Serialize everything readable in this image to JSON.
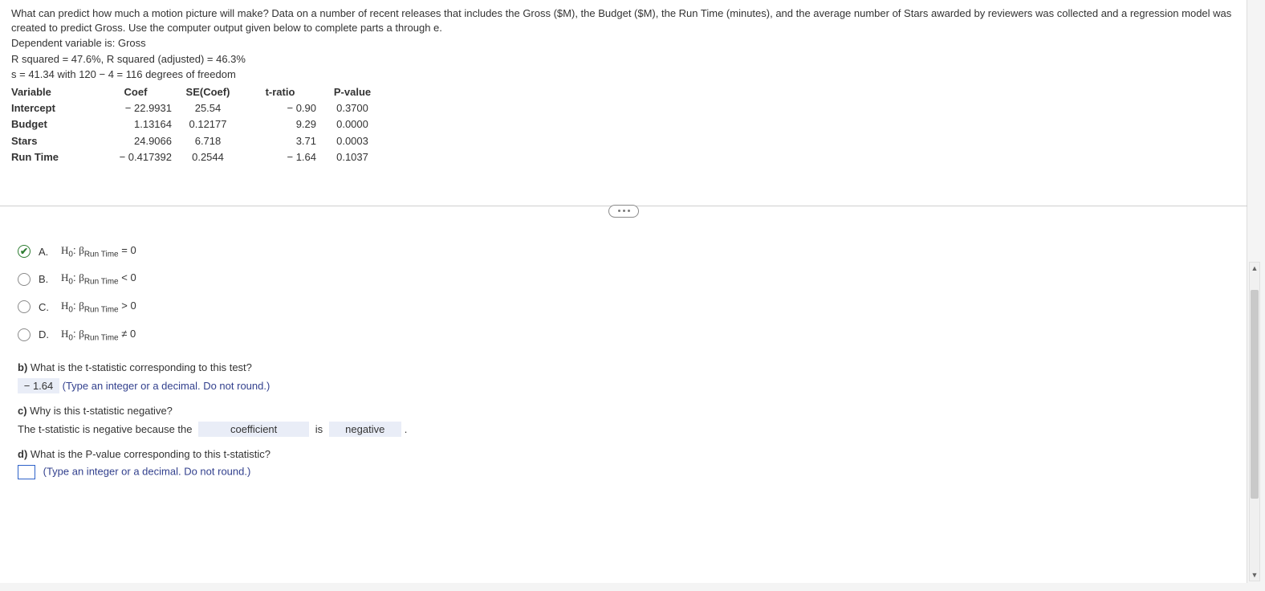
{
  "intro1": "What can predict how much a motion picture will make? Data on a number of recent releases that includes the Gross ($M), the Budget ($M), the Run Time (minutes), and the average number of Stars awarded by reviewers was collected and a regression model was created to predict Gross. Use the computer output given below to complete parts a through e.",
  "dep": "Dependent variable is: Gross",
  "rsq": "R squared = 47.6%, R squared (adjusted) = 46.3%",
  "sline": "s = 41.34 with 120 − 4 = 116 degrees of freedom",
  "table": {
    "headers": {
      "c0": "Variable",
      "c1": "Coef",
      "c2": "SE(Coef)",
      "c3": "t-ratio",
      "c4": "P-value"
    },
    "rows": [
      {
        "c0": "Intercept",
        "c1": "− 22.9931",
        "c2": "25.54",
        "c3": "− 0.90",
        "c4": "0.3700"
      },
      {
        "c0": "Budget",
        "c1": "1.13164",
        "c2": "0.12177",
        "c3": "9.29",
        "c4": "0.0000"
      },
      {
        "c0": "Stars",
        "c1": "24.9066",
        "c2": "6.718",
        "c3": "3.71",
        "c4": "0.0003"
      },
      {
        "c0": "Run Time",
        "c1": "− 0.417392",
        "c2": "0.2544",
        "c3": "− 1.64",
        "c4": "0.1037"
      }
    ]
  },
  "options": {
    "A": {
      "letter": "A.",
      "rel": "= 0"
    },
    "B": {
      "letter": "B.",
      "rel": "< 0"
    },
    "C": {
      "letter": "C.",
      "rel": "> 0"
    },
    "D": {
      "letter": "D.",
      "rel": "≠ 0"
    }
  },
  "hyp_label_prefix": "H",
  "hyp_label_sub": "0",
  "hyp_beta": "β",
  "hyp_beta_sub": "Run Time",
  "qb_label": "b)",
  "qb_text": " What is the t-statistic corresponding to this test?",
  "answer_b": "− 1.64",
  "hint_b": "  (Type an integer or a decimal. Do not round.)",
  "qc_label": "c)",
  "qc_text": " Why is this t-statistic negative?",
  "sentence_c_pre": "The t-statistic is negative because the ",
  "dd1": "coefficient",
  "sentence_c_mid": " is ",
  "dd2": "negative",
  "sentence_c_post": ".",
  "qd_label": "d)",
  "qd_text": " What is the P-value corresponding to this t-statistic?",
  "hint_d": " (Type an integer or a decimal. Do not round.)",
  "scroll_up": "▲",
  "scroll_down": "▼"
}
